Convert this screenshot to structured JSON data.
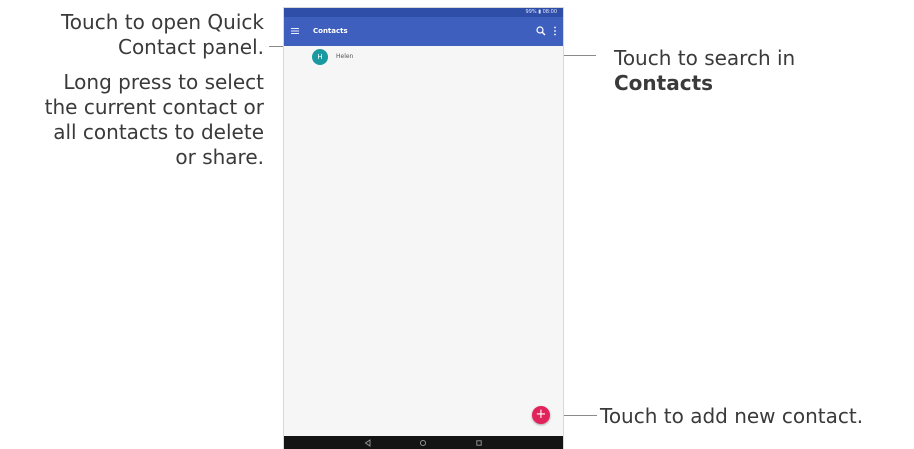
{
  "callouts": {
    "quick_contact": {
      "line1": "Touch to open Quick",
      "line2": "Contact panel."
    },
    "long_press": {
      "line1": "Long press to select",
      "line2": "the current contact or",
      "line3": "all contacts to delete",
      "line4": "or share."
    },
    "search": {
      "line1": "Touch to search in",
      "line2": "Contacts"
    },
    "add": "Touch to add new contact."
  },
  "status_bar": {
    "text": "99% ▮ 08:00"
  },
  "app_bar": {
    "title": "Contacts",
    "color": "#3f5fbf",
    "icons": [
      "menu-icon",
      "search-icon",
      "more-vert-icon"
    ]
  },
  "contacts": [
    {
      "initial": "H",
      "name": "Helen",
      "avatar_color": "#1a9aa0"
    }
  ],
  "fab": {
    "symbol": "+",
    "color": "#e2225a"
  },
  "nav_bar": {
    "icons": [
      "back-icon",
      "home-icon",
      "recents-icon"
    ]
  }
}
